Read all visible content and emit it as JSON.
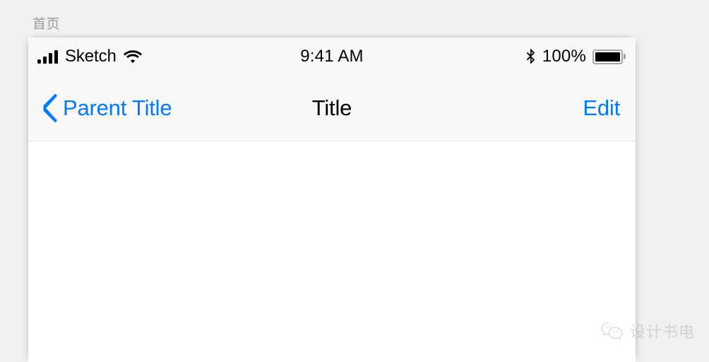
{
  "page": {
    "breadcrumb": "首页",
    "background_color": "#f0f0f0"
  },
  "device": {
    "status_bar": {
      "signal_icon": "signal-bars-icon",
      "carrier": "Sketch",
      "wifi_icon": "wifi-icon",
      "time": "9:41 AM",
      "bluetooth_icon": "bluetooth-icon",
      "battery_percent": "100%",
      "battery_icon": "battery-full-icon",
      "background_color": "#f8f8f8"
    },
    "nav_bar": {
      "back_icon": "chevron-left-icon",
      "back_label": "Parent Title",
      "title": "Title",
      "right_action": "Edit",
      "accent_color": "#007aff",
      "background_color": "#f8f8f8"
    },
    "content": {
      "background_color": "#ffffff"
    }
  },
  "watermark": {
    "logo_icon": "wechat-icon",
    "text": "设计书电"
  }
}
